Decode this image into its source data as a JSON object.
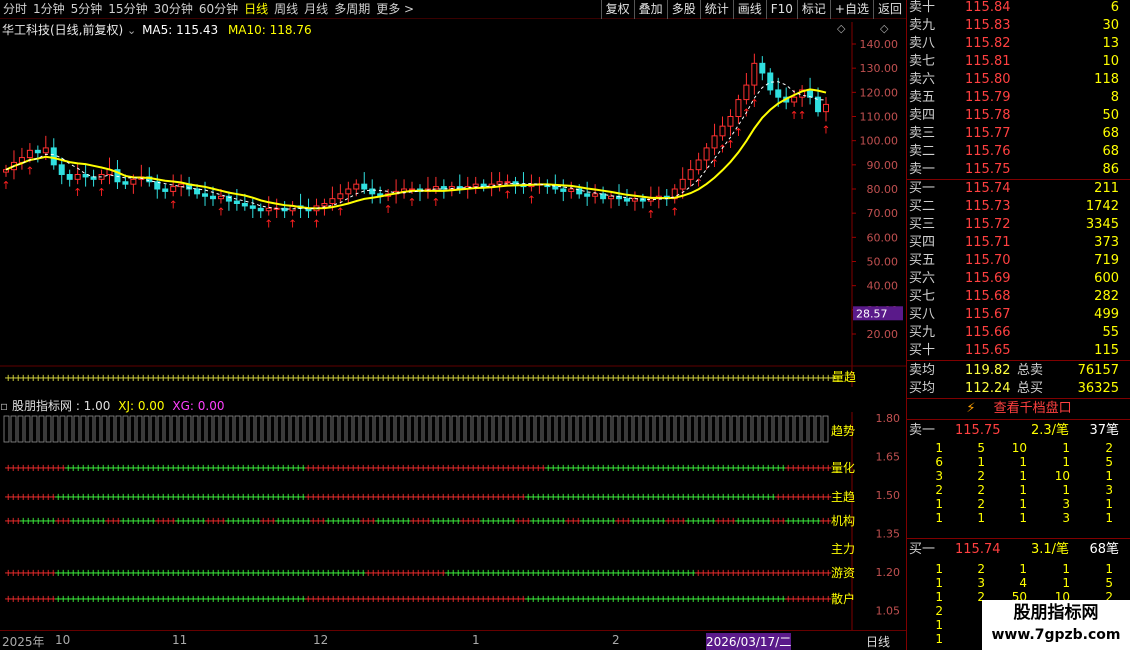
{
  "toolbar": {
    "tabs": [
      "分时",
      "1分钟",
      "5分钟",
      "15分钟",
      "30分钟",
      "60分钟",
      "日线",
      "周线",
      "月线",
      "多周期",
      "更多 >"
    ],
    "active_tab": "日线",
    "buttons": [
      "复权",
      "叠加",
      "多股",
      "统计",
      "画线",
      "F10",
      "标记",
      "+自选",
      "返回"
    ]
  },
  "main": {
    "stock_name": "华工科技(日线,前复权)",
    "ma5_label": "MA5: 115.43",
    "ma10_label": "MA10: 118.76",
    "price_axis": [
      "140.00",
      "130.00",
      "120.00",
      "110.00",
      "100.00",
      "90.00",
      "80.00",
      "70.00",
      "60.00",
      "50.00",
      "40.00",
      "30.00",
      "20.00"
    ],
    "low_price_tag": "28.57",
    "indicator_strip_label": "量趋"
  },
  "indicator": {
    "title": "股朋指标网",
    "value": ": 1.00",
    "xj": "XJ: 0.00",
    "xg": "XG: 0.00",
    "rows": [
      "趋势",
      "量化",
      "主趋",
      "机构",
      "主力",
      "游资",
      "散户"
    ],
    "axis": [
      "1.80",
      "1.65",
      "1.50",
      "1.35",
      "1.20",
      "1.05"
    ]
  },
  "timebar": {
    "labels": [
      "2025年",
      "10",
      "11",
      "12",
      "1",
      "2"
    ],
    "current_date": "2026/03/17/二",
    "period": "日线"
  },
  "orderbook": {
    "asks": [
      {
        "label": "卖十",
        "price": "115.84",
        "vol": "6"
      },
      {
        "label": "卖九",
        "price": "115.83",
        "vol": "30"
      },
      {
        "label": "卖八",
        "price": "115.82",
        "vol": "13"
      },
      {
        "label": "卖七",
        "price": "115.81",
        "vol": "10"
      },
      {
        "label": "卖六",
        "price": "115.80",
        "vol": "118"
      },
      {
        "label": "卖五",
        "price": "115.79",
        "vol": "8"
      },
      {
        "label": "卖四",
        "price": "115.78",
        "vol": "50"
      },
      {
        "label": "卖三",
        "price": "115.77",
        "vol": "68"
      },
      {
        "label": "卖二",
        "price": "115.76",
        "vol": "68"
      },
      {
        "label": "卖一",
        "price": "115.75",
        "vol": "86"
      }
    ],
    "bids": [
      {
        "label": "买一",
        "price": "115.74",
        "vol": "211"
      },
      {
        "label": "买二",
        "price": "115.73",
        "vol": "1742"
      },
      {
        "label": "买三",
        "price": "115.72",
        "vol": "3345"
      },
      {
        "label": "买四",
        "price": "115.71",
        "vol": "373"
      },
      {
        "label": "买五",
        "price": "115.70",
        "vol": "719"
      },
      {
        "label": "买六",
        "price": "115.69",
        "vol": "600"
      },
      {
        "label": "买七",
        "price": "115.68",
        "vol": "282"
      },
      {
        "label": "买八",
        "price": "115.67",
        "vol": "499"
      },
      {
        "label": "买九",
        "price": "115.66",
        "vol": "55"
      },
      {
        "label": "买十",
        "price": "115.65",
        "vol": "115"
      }
    ],
    "avg_sell_label": "卖均",
    "avg_sell": "119.82",
    "total_sell_label": "总卖",
    "total_sell": "76157",
    "avg_buy_label": "买均",
    "avg_buy": "112.24",
    "total_buy_label": "总买",
    "total_buy": "36325",
    "view_thousand": "查看千档盘口",
    "sell1_label": "卖一",
    "sell1_price": "115.75",
    "sell1_avg": "2.3/笔",
    "sell1_count": "37笔",
    "sell1_grid": [
      [
        "1",
        "5",
        "10",
        "1",
        "2"
      ],
      [
        "6",
        "1",
        "1",
        "1",
        "5"
      ],
      [
        "3",
        "2",
        "1",
        "10",
        "1"
      ],
      [
        "2",
        "2",
        "1",
        "1",
        "3"
      ],
      [
        "1",
        "2",
        "1",
        "3",
        "1"
      ],
      [
        "1",
        "1",
        "1",
        "3",
        "1"
      ]
    ],
    "buy1_label": "买一",
    "buy1_price": "115.74",
    "buy1_avg": "3.1/笔",
    "buy1_count": "68笔",
    "buy1_grid": [
      [
        "1",
        "2",
        "1",
        "1",
        "1"
      ],
      [
        "1",
        "3",
        "4",
        "1",
        "5"
      ],
      [
        "1",
        "2",
        "50",
        "10",
        "2"
      ],
      [
        "2",
        "",
        "",
        "",
        ""
      ],
      [
        "1",
        "",
        "",
        "",
        ""
      ],
      [
        "1",
        "",
        "",
        "",
        ""
      ]
    ]
  },
  "watermark": {
    "title": "股朋指标网",
    "url": "www.7gpzb.com"
  }
}
